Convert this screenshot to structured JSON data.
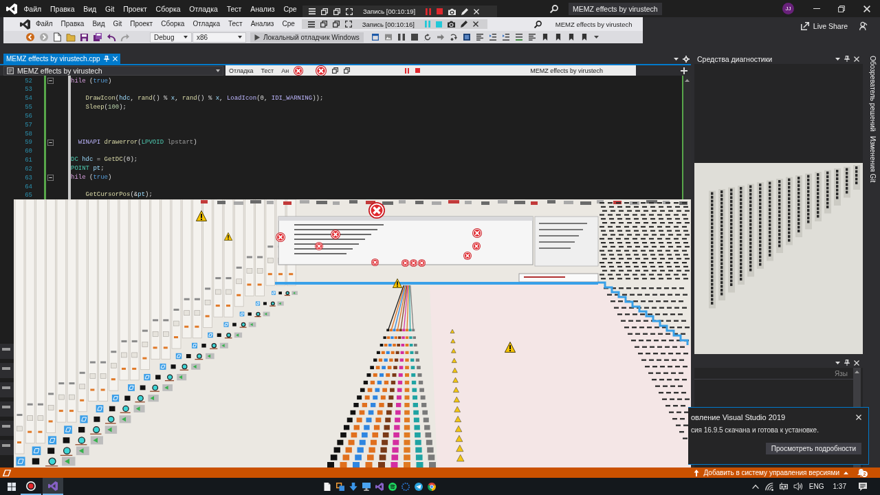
{
  "title_bar": {
    "menu": [
      "Файл",
      "Правка",
      "Вид",
      "Git",
      "Проект",
      "Сборка",
      "Отладка",
      "Тест",
      "Анализ",
      "Сре"
    ],
    "recorder_time": "Запись [00:10:19]",
    "solution": "MEMZ effects by virustech",
    "avatar": "JJ"
  },
  "nested_window": {
    "menu": [
      "Файл",
      "Правка",
      "Вид",
      "Git",
      "Проект",
      "Сборка",
      "Отладка",
      "Тест",
      "Анализ",
      "Сре"
    ],
    "recorder_time": "Запись [00:10:16]",
    "solution": "MEMZ effects by virustech",
    "configuration": "Debug",
    "platform": "x86",
    "debugger": "Локальный отладчик Windows"
  },
  "live_share": "Live Share",
  "editor": {
    "tabs": [
      {
        "label": "MEMZ effects by virustech.cpp",
        "selected": true
      }
    ],
    "scope": "MEMZ effects by virustech",
    "overlay": [
      "Отладка",
      "Тест",
      "Ан",
      "MEMZ effects by virustech"
    ],
    "lines": [
      {
        "number": "52",
        "fold": true,
        "tokens": [
          {
            "kind": "control",
            "text": "hile"
          },
          {
            "kind": "plain",
            "text": " ("
          },
          {
            "kind": "keyword",
            "text": "true"
          },
          {
            "kind": "plain",
            "text": ")"
          }
        ]
      },
      {
        "number": "53",
        "fold": false
      },
      {
        "number": "54",
        "fold": false,
        "tokens": [
          {
            "kind": "function",
            "text": "    DrawIcon"
          },
          {
            "kind": "plain",
            "text": "("
          },
          {
            "kind": "variable",
            "text": "hdc"
          },
          {
            "kind": "plain",
            "text": ", "
          },
          {
            "kind": "function",
            "text": "rand"
          },
          {
            "kind": "plain",
            "text": "() % "
          },
          {
            "kind": "variable",
            "text": "x"
          },
          {
            "kind": "plain",
            "text": ", "
          },
          {
            "kind": "function",
            "text": "rand"
          },
          {
            "kind": "plain",
            "text": "() % "
          },
          {
            "kind": "variable",
            "text": "x"
          },
          {
            "kind": "plain",
            "text": ", "
          },
          {
            "kind": "macro",
            "text": "LoadIcon"
          },
          {
            "kind": "plain",
            "text": "(0, "
          },
          {
            "kind": "macro",
            "text": "IDI_WARNING"
          },
          {
            "kind": "plain",
            "text": "));"
          }
        ]
      },
      {
        "number": "55",
        "fold": false,
        "tokens": [
          {
            "kind": "function",
            "text": "    Sleep"
          },
          {
            "kind": "plain",
            "text": "("
          },
          {
            "kind": "number",
            "text": "100"
          },
          {
            "kind": "plain",
            "text": ");"
          }
        ]
      },
      {
        "number": "56",
        "fold": false
      },
      {
        "number": "57",
        "fold": false
      },
      {
        "number": "58",
        "fold": false
      },
      {
        "number": "59",
        "fold": true,
        "tokens": [
          {
            "kind": "macro",
            "text": "  WINAPI "
          },
          {
            "kind": "function",
            "text": "drawerror"
          },
          {
            "kind": "plain",
            "text": "("
          },
          {
            "kind": "type",
            "text": "LPVOID "
          },
          {
            "kind": "param",
            "text": "lpstart"
          },
          {
            "kind": "plain",
            "text": ")"
          }
        ]
      },
      {
        "number": "60",
        "fold": false
      },
      {
        "number": "61",
        "fold": false,
        "tokens": [
          {
            "kind": "type",
            "text": "DC "
          },
          {
            "kind": "variable",
            "text": "hdc"
          },
          {
            "kind": "plain",
            "text": " = "
          },
          {
            "kind": "function",
            "text": "GetDC"
          },
          {
            "kind": "plain",
            "text": "(0);"
          }
        ]
      },
      {
        "number": "62",
        "fold": false,
        "tokens": [
          {
            "kind": "type",
            "text": "POINT "
          },
          {
            "kind": "variable",
            "text": "pt"
          },
          {
            "kind": "plain",
            "text": ";"
          }
        ]
      },
      {
        "number": "63",
        "fold": true,
        "tokens": [
          {
            "kind": "control",
            "text": "hile"
          },
          {
            "kind": "plain",
            "text": " ("
          },
          {
            "kind": "keyword",
            "text": "true"
          },
          {
            "kind": "plain",
            "text": ")"
          }
        ]
      },
      {
        "number": "64",
        "fold": false
      },
      {
        "number": "65",
        "fold": false,
        "tokens": [
          {
            "kind": "function",
            "text": "    GetCursorPos"
          },
          {
            "kind": "plain",
            "text": "(&"
          },
          {
            "kind": "variable",
            "text": "pt"
          },
          {
            "kind": "plain",
            "text": ");"
          }
        ]
      }
    ]
  },
  "diagnostics": {
    "title": "Средства диагностики"
  },
  "lower_panel": {
    "column_header": "Язы"
  },
  "side_tabs": [
    "Обозреватель решений",
    "Изменения Git"
  ],
  "notification": {
    "title": "овление Visual Studio 2019",
    "message": "сия 16.9.5 скачана и готова к установке.",
    "button": "Просмотреть подробности"
  },
  "status_bar": {
    "action": "Добавить в систему управления версиями",
    "badge": "2"
  },
  "taskbar": {
    "apps": [
      {
        "running": true,
        "selected": false
      },
      {
        "running": true,
        "selected": true
      }
    ],
    "language": "ENG",
    "time": "1:37"
  }
}
